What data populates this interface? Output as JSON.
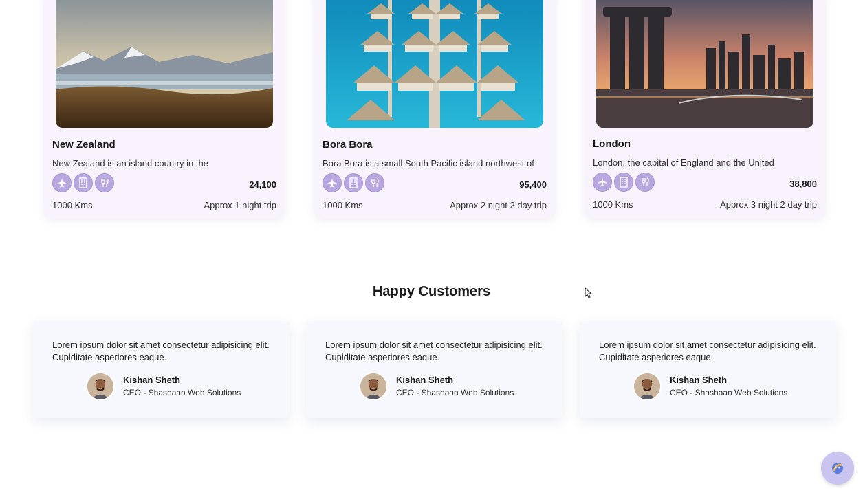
{
  "destinations": [
    {
      "title": "New Zealand",
      "description": "New Zealand is an island country in the",
      "price": "24,100",
      "distance": "1000 Kms",
      "trip": "Approx 1 night trip"
    },
    {
      "title": "Bora Bora",
      "description": "Bora Bora is a small South Pacific island northwest of",
      "price": "95,400",
      "distance": "1000 Kms",
      "trip": "Approx 2 night 2 day trip"
    },
    {
      "title": "London",
      "description": "London, the capital of England and the United",
      "price": "38,800",
      "distance": "1000 Kms",
      "trip": "Approx 3 night 2 day trip"
    }
  ],
  "amenity_icons": [
    "plane-icon",
    "hotel-icon",
    "food-icon"
  ],
  "testimonials_section": {
    "title": "Happy Customers",
    "items": [
      {
        "quote": "Lorem ipsum dolor sit amet consectetur adipisicing elit. Cupiditate asperiores eaque.",
        "name": "Kishan Sheth",
        "role": "CEO - Shashaan Web Solutions"
      },
      {
        "quote": "Lorem ipsum dolor sit amet consectetur adipisicing elit. Cupiditate asperiores eaque.",
        "name": "Kishan Sheth",
        "role": "CEO - Shashaan Web Solutions"
      },
      {
        "quote": "Lorem ipsum dolor sit amet consectetur adipisicing elit. Cupiditate asperiores eaque.",
        "name": "Kishan Sheth",
        "role": "CEO - Shashaan Web Solutions"
      }
    ]
  },
  "colors": {
    "card_bg": "#f8f3fd",
    "amenity_bg": "#b9a7e0",
    "testimonial_bg": "#f6f8fe"
  }
}
